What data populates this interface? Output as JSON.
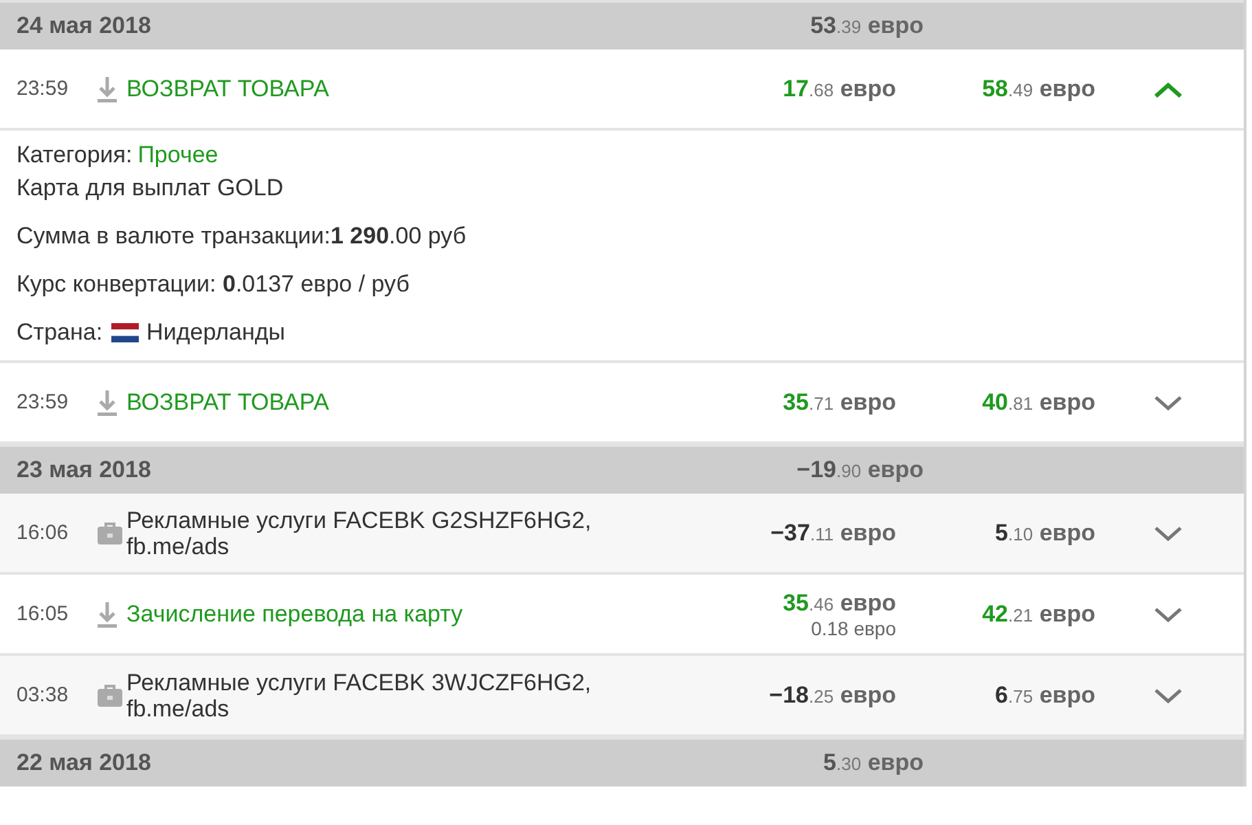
{
  "days": [
    {
      "date": "24 мая 2018",
      "total": {
        "whole": "53",
        "fraction": ".39",
        "currency": "евро"
      },
      "transactions": [
        {
          "kind": "income",
          "time": "23:59",
          "title": "ВОЗВРАТ ТОВАРА",
          "amount": {
            "whole": "17",
            "fraction": ".68",
            "currency": "евро"
          },
          "balance": {
            "whole": "58",
            "fraction": ".49",
            "currency": "евро"
          },
          "expanded": true,
          "details": [
            {
              "kind": "category",
              "label": "Категория:",
              "value": "Прочее"
            },
            {
              "kind": "text",
              "text": "Карта для выплат GOLD"
            },
            {
              "kind": "text",
              "text": "Сумма в валюте транзакции:**1 290**.00 руб"
            },
            {
              "kind": "text",
              "text": "Курс конвертации: **0**.0137 евро / руб"
            },
            {
              "kind": "country",
              "label": "Страна:",
              "value": "Нидерланды"
            }
          ]
        },
        {
          "kind": "income",
          "time": "23:59",
          "title": "ВОЗВРАТ ТОВАРА",
          "amount": {
            "whole": "35",
            "fraction": ".71",
            "currency": "евро"
          },
          "balance": {
            "whole": "40",
            "fraction": ".81",
            "currency": "евро"
          },
          "expanded": false
        }
      ]
    },
    {
      "date": "23 мая 2018",
      "total": {
        "whole": "−19",
        "fraction": ".90",
        "currency": "евро"
      },
      "transactions": [
        {
          "kind": "purchase",
          "time": "16:06",
          "title": "Рекламные услуги FACEBK G2SHZF6HG2, fb.me/ads",
          "amount": {
            "whole": "−37",
            "fraction": ".11",
            "currency": "евро"
          },
          "balance": {
            "whole": "5",
            "fraction": ".10",
            "currency": "евро"
          },
          "expanded": false
        },
        {
          "kind": "income",
          "time": "16:05",
          "title": "Зачисление перевода на карту",
          "amount": {
            "whole": "35",
            "fraction": ".46",
            "currency": "евро"
          },
          "fee": "0.18 евро",
          "balance": {
            "whole": "42",
            "fraction": ".21",
            "currency": "евро"
          },
          "expanded": false
        },
        {
          "kind": "purchase",
          "time": "03:38",
          "title": "Рекламные услуги FACEBK 3WJCZF6HG2, fb.me/ads",
          "amount": {
            "whole": "−18",
            "fraction": ".25",
            "currency": "евро"
          },
          "balance": {
            "whole": "6",
            "fraction": ".75",
            "currency": "евро"
          },
          "expanded": false
        }
      ]
    },
    {
      "date": "22 мая 2018",
      "total": {
        "whole": "5",
        "fraction": ".30",
        "currency": "евро"
      }
    }
  ]
}
